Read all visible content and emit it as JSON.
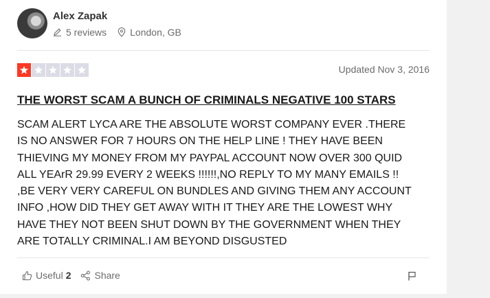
{
  "reviewer": {
    "name": "Alex Zapak",
    "reviews": "5 reviews",
    "location": "London, GB"
  },
  "rating": {
    "stars_filled": 1,
    "stars_total": 5
  },
  "review": {
    "updated": "Updated Nov 3, 2016",
    "title": "THE WORST SCAM A BUNCH OF CRIMINALS NEGATIVE 100 STARS",
    "body": "SCAM ALERT LYCA ARE THE ABSOLUTE WORST COMPANY EVER .THERE\nIS NO ANSWER FOR 7 HOURS ON THE HELP LINE ! THEY HAVE BEEN\nTHIEVING MY MONEY FROM MY PAYPAL ACCOUNT NOW OVER 300 QUID\nALL YEArR 29.99 EVERY 2 WEEKS !!!!!!,NO REPLY TO MY MANY EMAILS !!\n,BE VERY VERY CAREFUL ON BUNDLES AND GIVING THEM ANY ACCOUNT\nINFO ,HOW DID THEY GET AWAY WITH IT THEY ARE THE LOWEST WHY\nHAVE THEY NOT BEEN SHUT DOWN BY THE GOVERNMENT WHEN THEY\nARE TOTALLY CRIMINAL.I AM BEYOND DISGUSTED"
  },
  "actions": {
    "useful_label": "Useful",
    "useful_count": "2",
    "share_label": "Share"
  },
  "icons": {
    "reviews": "pencil-icon",
    "location": "location-pin-icon",
    "useful": "thumbs-up-icon",
    "share": "share-icon",
    "report": "flag-icon",
    "rating": "star-icon"
  },
  "colors": {
    "star_on": "#ff3722",
    "star_off": "#dcdce6",
    "muted_text": "#6b6b6b"
  }
}
